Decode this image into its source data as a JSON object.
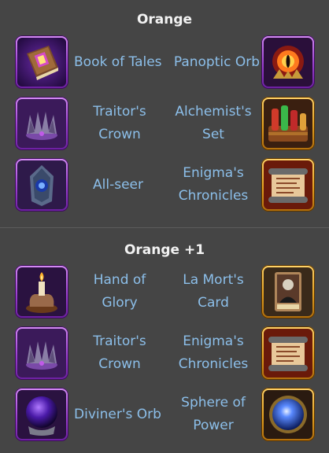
{
  "sections": [
    {
      "title": "Orange",
      "rows": [
        {
          "left": {
            "label": "Book of Tales",
            "icon": "book-of-tales-icon",
            "frame": "purple"
          },
          "right": {
            "label": "Panoptic Orb",
            "icon": "panoptic-orb-icon",
            "frame": "purple"
          }
        },
        {
          "left": {
            "label_lines": [
              "Traitor's",
              "Crown"
            ],
            "icon": "traitors-crown-icon",
            "frame": "purple"
          },
          "right": {
            "label_lines": [
              "Alchemist's",
              "Set"
            ],
            "icon": "alchemists-set-icon",
            "frame": "orange"
          }
        },
        {
          "left": {
            "label": "All-seer",
            "icon": "all-seer-icon",
            "frame": "purple"
          },
          "right": {
            "label_lines": [
              "Enigma's",
              "Chronicles"
            ],
            "icon": "enigmas-chronicles-icon",
            "frame": "orange"
          }
        }
      ]
    },
    {
      "title": "Orange +1",
      "rows": [
        {
          "left": {
            "label_lines": [
              "Hand of",
              "Glory"
            ],
            "icon": "hand-of-glory-icon",
            "frame": "purple"
          },
          "right": {
            "label_lines": [
              "La Mort's",
              "Card"
            ],
            "icon": "la-morts-card-icon",
            "frame": "orange"
          }
        },
        {
          "left": {
            "label_lines": [
              "Traitor's",
              "Crown"
            ],
            "icon": "traitors-crown-icon",
            "frame": "purple"
          },
          "right": {
            "label_lines": [
              "Enigma's",
              "Chronicles"
            ],
            "icon": "enigmas-chronicles-icon",
            "frame": "orange"
          }
        },
        {
          "left": {
            "label": "Diviner's Orb",
            "icon": "diviners-orb-icon",
            "frame": "purple"
          },
          "right": {
            "label_lines": [
              "Sphere of",
              "Power"
            ],
            "icon": "sphere-of-power-icon",
            "frame": "orange"
          }
        }
      ]
    }
  ],
  "colors": {
    "background": "#454545",
    "title_text": "#f2f2f2",
    "item_text": "#8cbfea",
    "frame_purple": "#a64fd8",
    "frame_orange": "#e6a21f"
  }
}
